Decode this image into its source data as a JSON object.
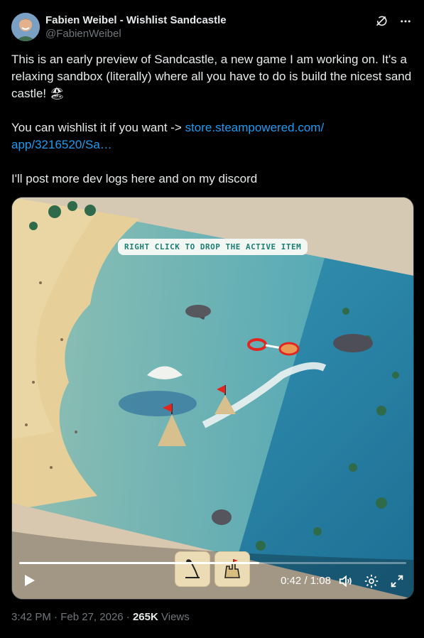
{
  "author": {
    "display_name": "Fabien Weibel - Wishlist Sandcastle",
    "handle": "@FabienWeibel"
  },
  "header_icons": [
    "grok-icon",
    "more-icon"
  ],
  "tweet": {
    "line1": "This is an early preview of Sandcastle, a new game I am working on. It's a relaxing sandbox (literally) where all you have to do is build the nicest sand castle! 🏖",
    "line2_prefix": "You can wishlist it if you want -> ",
    "link_text": "store.steampowered.com/\napp/3216520/Sa…",
    "line3": "I'll post more dev logs here and on my discord"
  },
  "video": {
    "tooltip": "RIGHT CLICK TO DROP THE ACTIVE ITEM",
    "current_time": "0:42",
    "duration": "1:08",
    "progress": 0.62,
    "toolbar_items": [
      "sand-scoop-tool-icon",
      "sand-castle-tool-icon"
    ]
  },
  "meta": {
    "time": "3:42 PM",
    "date": "Feb 27, 2026",
    "views_count": "265K",
    "views_label": "Views"
  },
  "colors": {
    "link": "#1d9bf0",
    "text": "#e7e9ea",
    "muted": "#71767b",
    "background": "#000000"
  }
}
